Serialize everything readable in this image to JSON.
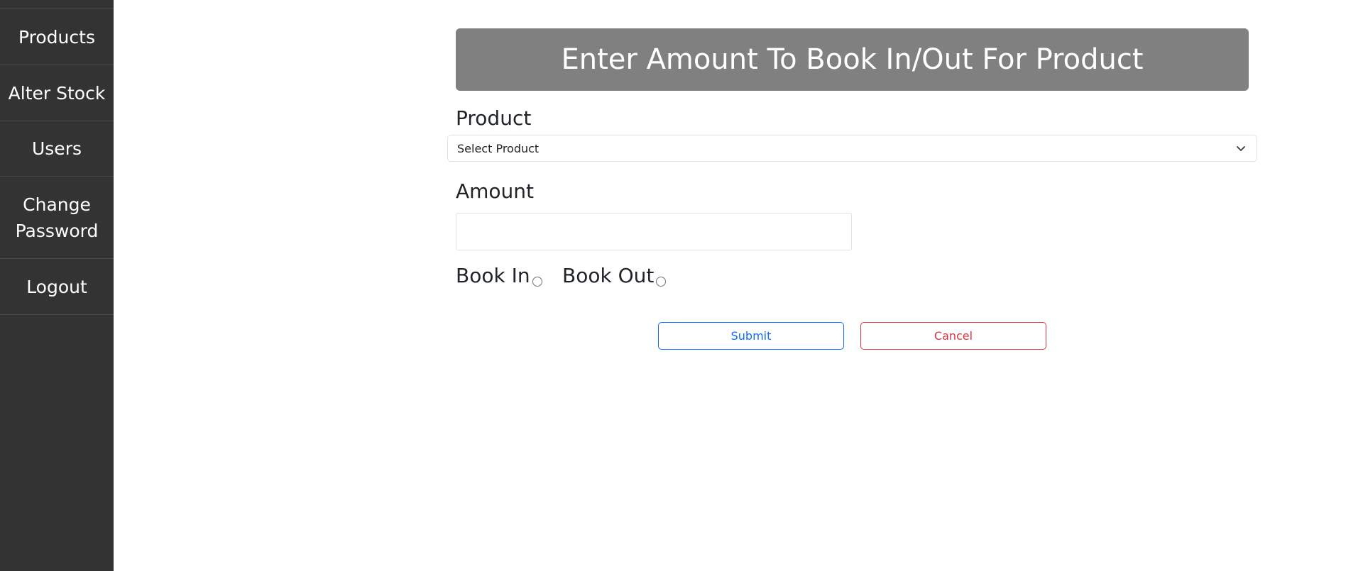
{
  "sidebar": {
    "items": [
      {
        "label": "Products"
      },
      {
        "label": "Alter Stock"
      },
      {
        "label": "Users"
      },
      {
        "label": "Change Password"
      },
      {
        "label": "Logout"
      }
    ]
  },
  "form": {
    "title": "Enter Amount To Book In/Out For Product",
    "product_label": "Product",
    "product_select_value": "Select Product",
    "amount_label": "Amount",
    "amount_value": "",
    "book_in_label": "Book In",
    "book_out_label": "Book Out",
    "book_in_checked": false,
    "book_out_checked": false,
    "submit_label": "Submit",
    "cancel_label": "Cancel"
  },
  "colors": {
    "sidebar_bg": "#333333",
    "banner_bg": "#808080",
    "submit": "#0d6efd",
    "cancel": "#dc3545"
  },
  "icons": {
    "select_caret": "chevron-down-icon"
  }
}
